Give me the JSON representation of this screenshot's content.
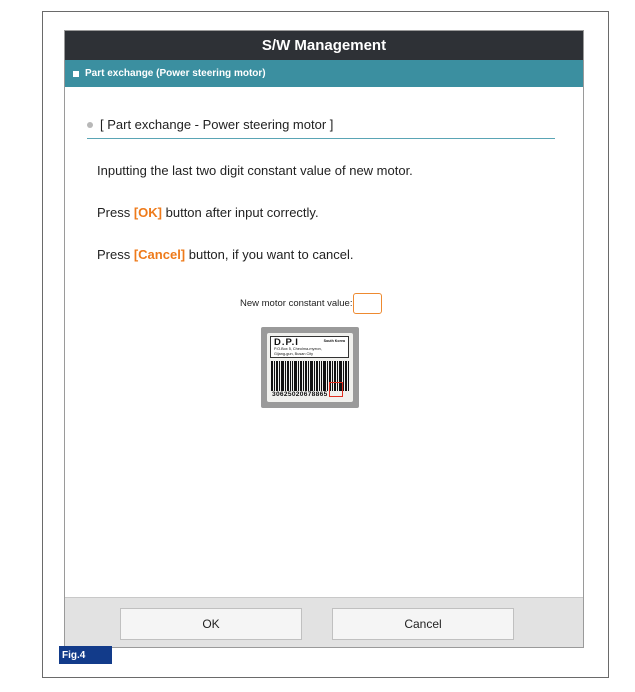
{
  "window": {
    "title": "S/W Management"
  },
  "subheader": {
    "label": "Part exchange (Power steering motor)"
  },
  "section": {
    "title": "[ Part exchange - Power steering motor ]"
  },
  "instructions": {
    "line1": "Inputting the last two digit constant value of new motor.",
    "line2_pre": "Press ",
    "line2_hl": "[OK]",
    "line2_post": " button after input correctly.",
    "line3_pre": "Press ",
    "line3_hl": "[Cancel]",
    "line3_post": " button, if you want to cancel."
  },
  "input": {
    "label": "New motor constant value:",
    "value": ""
  },
  "motor_label": {
    "brand": "D.P.I",
    "country": "South Korea",
    "address_line1": "P.O.Box 5, Cheolma-myeon,",
    "address_line2": "Gijang-gun, Busan City",
    "barcode_number": "30625020678865"
  },
  "buttons": {
    "ok": "OK",
    "cancel": "Cancel"
  },
  "figure": {
    "label": "Fig.4"
  },
  "colors": {
    "titlebar": "#2e3136",
    "subheader": "#3b8fa0",
    "highlight": "#ee7a1a",
    "fig_label": "#123b8a"
  }
}
